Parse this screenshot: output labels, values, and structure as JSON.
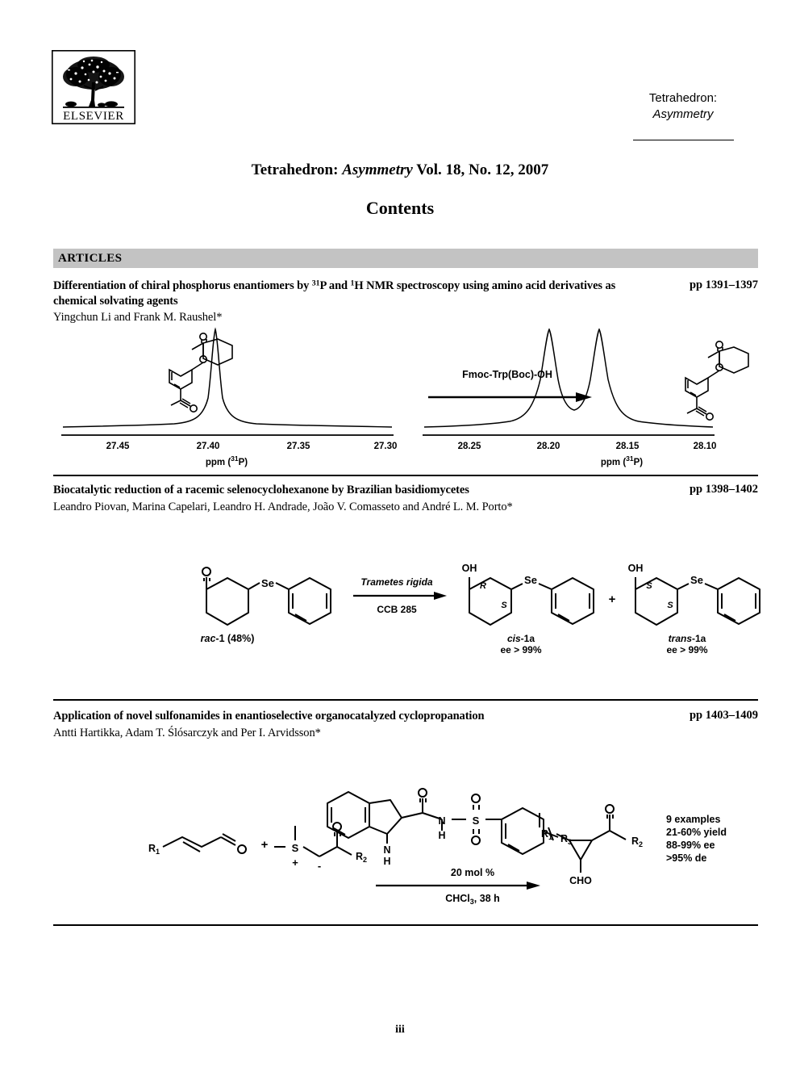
{
  "publisher": {
    "name": "ELSEVIER",
    "logo_icon": "elsevier-tree-logo"
  },
  "journal": {
    "line1": "Tetrahedron:",
    "line2": "Asymmetry"
  },
  "issue": {
    "prefix": "Tetrahedron: ",
    "italic": "Asymmetry",
    "suffix": " Vol. 18, No. 12, 2007"
  },
  "contents_heading": "Contents",
  "section": {
    "label": "ARTICLES"
  },
  "articles": [
    {
      "title_part1": "Differentiation of chiral phosphorus enantiomers by ",
      "title_sup1": "31",
      "title_part2": "P and ",
      "title_sup2": "1",
      "title_part3": "H NMR spectroscopy using amino acid derivatives as chemical solvating agents",
      "authors": "Yingchun Li and Frank M. Raushel*",
      "pages": "pp 1391–1397",
      "graphic": {
        "reagent": "Fmoc-Trp(Boc)-OH",
        "left_spectrum": {
          "axis_label_pre": "ppm (",
          "axis_label_sup": "31",
          "axis_label_post": "P)",
          "ticks": [
            "27.45",
            "27.40",
            "27.35",
            "27.30"
          ],
          "peaks": [
            {
              "position": "27.39",
              "relative_height": 1.0
            }
          ]
        },
        "right_spectrum": {
          "axis_label_pre": "ppm (",
          "axis_label_sup": "31",
          "axis_label_post": "P)",
          "ticks": [
            "28.25",
            "28.20",
            "28.15",
            "28.10"
          ],
          "peaks": [
            {
              "position": "28.21",
              "relative_height": 1.0
            },
            {
              "position": "28.17",
              "relative_height": 1.0
            }
          ]
        }
      }
    },
    {
      "title_part1": "Biocatalytic reduction of a racemic selenocyclohexanone by Brazilian basidiomycetes",
      "authors": "Leandro Piovan, Marina Capelari, Leandro H. Andrade, João V. Comasseto and André L. M. Porto*",
      "pages": "pp 1398–1402",
      "graphic": {
        "substrate_label_italic": "rac",
        "substrate_label_rest": "-1 (48%)",
        "substrate_atom": "Se",
        "substrate_carbonyl": "O",
        "reagent_top": "Trametes rigida",
        "reagent_bottom": "CCB 285",
        "plus": "+",
        "products": [
          {
            "oh": "OH",
            "stereo_top": "R",
            "stereo_bottom": "S",
            "atom": "Se",
            "name_italic": "cis",
            "name_rest": "-1a",
            "ee": "ee > 99%"
          },
          {
            "oh": "OH",
            "stereo_top": "S",
            "stereo_bottom": "S",
            "atom": "Se",
            "name_italic": "trans",
            "name_rest": "-1a",
            "ee": "ee > 99%"
          }
        ]
      }
    },
    {
      "title_part1": "Application of novel sulfonamides in enantioselective organocatalyzed cyclopropanation",
      "authors": "Antti Hartikka, Adam T. Ślósarczyk and Per I. Arvidsson*",
      "pages": "pp 1403–1409",
      "graphic": {
        "reactant1_label": "R",
        "reactant1_sub": "1",
        "reactant1_atom": "O",
        "plus": "+",
        "ylide_atom": "S",
        "ylide_charge_plus": "+",
        "ylide_charge_minus": "-",
        "ylide_carbonyl": "O",
        "ylide_label": "R",
        "ylide_sub": "2",
        "catalyst_nh": "N",
        "catalyst_h": "H",
        "catalyst_amide_o": "O",
        "catalyst_nh_link": "N",
        "catalyst_nh_link_h": "H",
        "catalyst_s": "S",
        "catalyst_so_top": "O",
        "catalyst_so_bottom": "O",
        "catalyst_r": "R",
        "catalyst_r_sub": "3",
        "loading": "20 mol %",
        "solvent_pre": "CHCl",
        "solvent_sub": "3",
        "solvent_post": ", 38 h",
        "product_r1": "R",
        "product_r1_sub": "1",
        "product_o": "O",
        "product_r2": "R",
        "product_r2_sub": "2",
        "product_cho": "CHO",
        "results": [
          "9 examples",
          "21-60% yield",
          "88-99% ee",
          ">95% de"
        ]
      }
    }
  ],
  "footer": {
    "page_number": "iii"
  }
}
